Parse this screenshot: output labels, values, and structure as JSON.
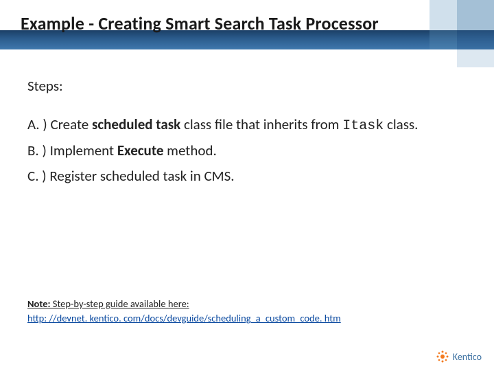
{
  "title": "Example - Creating Smart Search Task Processor",
  "steps_label": "Steps:",
  "steps": {
    "a_prefix": "A. ) Create ",
    "a_bold": "scheduled task",
    "a_mid": " class file that inherits from ",
    "a_code": "Itask",
    "a_suffix": " class.",
    "b_prefix": "B. ) Implement ",
    "b_bold": "Execute",
    "b_suffix": " method.",
    "c_text": "C. ) Register scheduled task in CMS."
  },
  "note": {
    "lead_bold": "Note:",
    "lead_rest": " Step-by-step guide available here:",
    "url": "http: //devnet. kentico. com/docs/devguide/scheduling_a_custom_code. htm"
  },
  "logo_text": "Kentico"
}
